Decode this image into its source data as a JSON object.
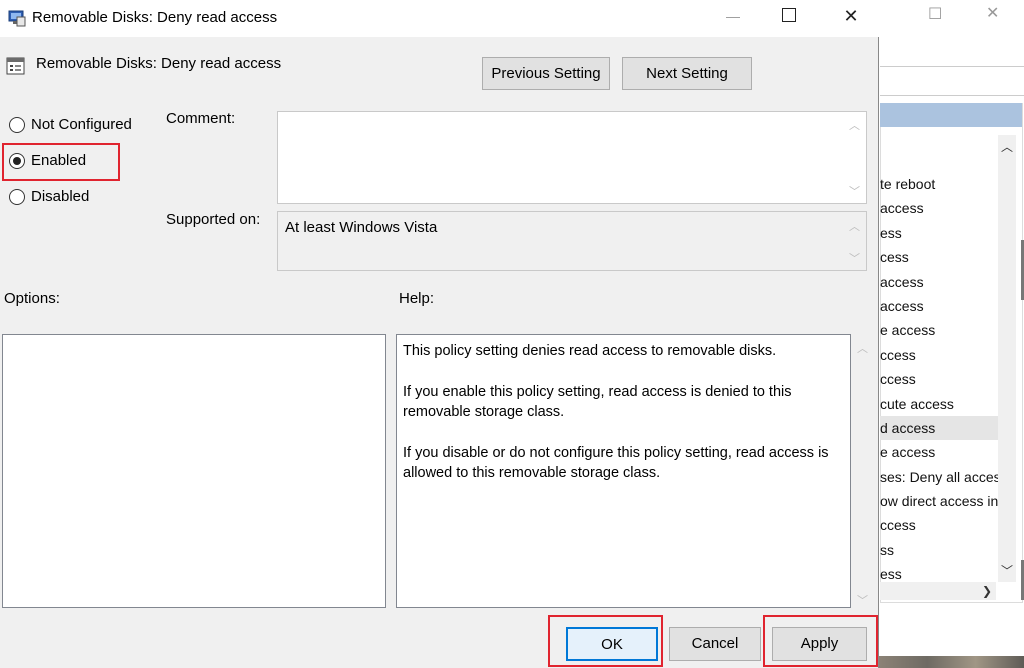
{
  "window": {
    "title": "Removable Disks: Deny read access",
    "min_glyph": "—",
    "max_glyph": "",
    "close_glyph": "✕"
  },
  "policy": {
    "name": "Removable Disks: Deny read access"
  },
  "nav": {
    "previous_label": "Previous Setting",
    "next_label": "Next Setting"
  },
  "state": {
    "options": [
      {
        "label": "Not Configured",
        "selected": false
      },
      {
        "label": "Enabled",
        "selected": true
      },
      {
        "label": "Disabled",
        "selected": false
      }
    ]
  },
  "comment": {
    "label": "Comment:",
    "value": ""
  },
  "supported": {
    "label": "Supported on:",
    "value": "At least Windows Vista"
  },
  "options_pane": {
    "label": "Options:"
  },
  "help": {
    "label": "Help:",
    "paragraphs": [
      "This policy setting denies read access to removable disks.",
      "If you enable this policy setting, read access is denied to this removable storage class.",
      "If you disable or do not configure this policy setting, read access is allowed to this removable storage class."
    ]
  },
  "buttons": {
    "ok": "OK",
    "cancel": "Cancel",
    "apply": "Apply"
  },
  "background_window": {
    "max_glyph": "☐",
    "close_glyph": "✕",
    "list_items": [
      "te reboot",
      "access",
      "ess",
      "cess",
      "access",
      "access",
      "e access",
      "ccess",
      "ccess",
      "cute access",
      "d access",
      "e access",
      "ses: Deny all access",
      "ow direct access in",
      "ccess",
      "ss",
      "ess"
    ],
    "selected_index": 10
  },
  "colors": {
    "highlight_red": "#e0242f",
    "focus_blue": "#0078d7"
  }
}
